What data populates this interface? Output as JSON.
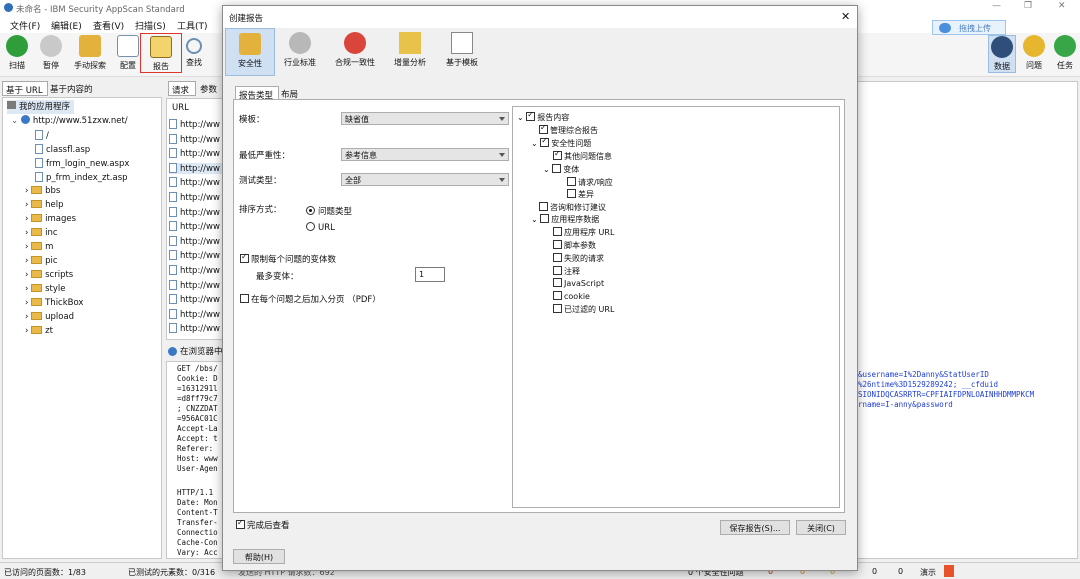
{
  "window": {
    "title": "未命名 - IBM Security AppScan Standard"
  },
  "menu": [
    "文件(F)",
    "编辑(E)",
    "查看(V)",
    "扫描(S)",
    "工具(T)"
  ],
  "toolbar": {
    "buttons": [
      "扫描",
      "暂停",
      "手动探索",
      "配置",
      "报告",
      "查找"
    ],
    "upload_label": "拖拽上传",
    "right_buttons": [
      "数据",
      "问题",
      "任务"
    ]
  },
  "left_panel": {
    "tabs": [
      "基于 URL",
      "基于内容的"
    ],
    "tree": {
      "root": "我的应用程序",
      "site": "http://www.51zxw.net/",
      "items": [
        "/",
        "classfl.asp",
        "frm_login_new.aspx",
        "p_frm_index_zt.asp",
        "bbs",
        "help",
        "images",
        "inc",
        "m",
        "pic",
        "scripts",
        "style",
        "ThickBox",
        "upload",
        "zt"
      ]
    }
  },
  "middle_panel": {
    "tabs": [
      "请求",
      "参数"
    ],
    "col_header": "URL",
    "url_prefix": "http://ww",
    "browser_label": "在浏览器中",
    "request_lines": [
      "GET /bbs/",
      "Cookie: D",
      "=1631291l",
      "=d8ff79c7",
      "; CNZZDAT",
      "=956AC01C",
      "Accept-La",
      "Accept: t",
      "Referer: ",
      "Host: www",
      "User-Agen"
    ],
    "response_lines": [
      "HTTP/1.1",
      "Date: Mon",
      "Content-T",
      "Transfer-",
      "Connectio",
      "Cache-Con",
      "Vary: Acc"
    ]
  },
  "right_text_lines": [
    "&username=I%2Danny&StatUserID",
    "%26ntime%3D1529289242; __cfduid",
    "SIONIDQCASRRTR=CPFIAIFDPNLOAINHHDMMPKCM",
    "rname=I-anny&password"
  ],
  "status": {
    "visited": "已访问的页面数：1/83",
    "tested": "已测试的元素数：0/316",
    "sent": "发送的 HTTP 请求数：692",
    "security": "0 个安全性问题",
    "c1": "0",
    "c2": "0",
    "c3": "0",
    "c4": "0",
    "c5": "0",
    "extra": "演示"
  },
  "dialog": {
    "title": "创建报告",
    "tabs": [
      "安全性",
      "行业标准",
      "合规一致性",
      "增量分析",
      "基于模板"
    ],
    "inner_tabs": [
      "报告类型",
      "布局"
    ],
    "template_label": "模板：",
    "template_value": "缺省值",
    "min_severity_label": "最低严重性：",
    "min_severity_value": "参考信息",
    "test_type_label": "测试类型：",
    "test_type_value": "全部",
    "sort_label": "排序方式：",
    "sort_options": [
      "问题类型",
      "URL"
    ],
    "limit_variants_label": "限制每个问题的变体数",
    "max_variants_label": "最多变体：",
    "max_variants_value": "1",
    "page_break_label": "在每个问题之后加入分页 （PDF）",
    "content_tree": [
      "报告内容",
      "管理综合报告",
      "安全性问题",
      "其他问题信息",
      "变体",
      "请求/响应",
      "差异",
      "咨询和修订建议",
      "应用程序数据",
      "应用程序 URL",
      "脚本参数",
      "失败的请求",
      "注释",
      "JavaScript",
      "cookie",
      "已过滤的 URL"
    ],
    "view_after_label": "完成后查看",
    "save_button": "保存报告(S)...",
    "close_button": "关闭(C)",
    "help_button": "帮助(H)"
  }
}
